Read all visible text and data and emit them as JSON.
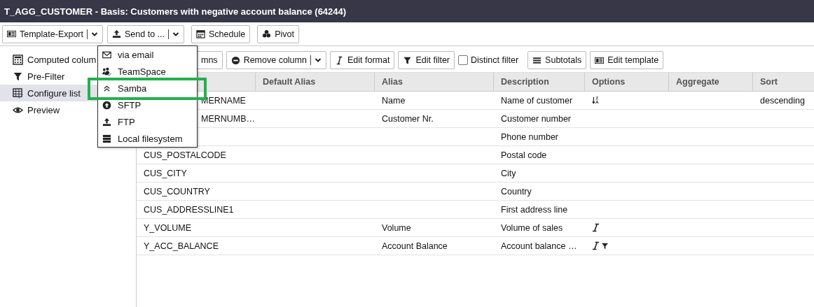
{
  "window": {
    "title": "T_AGG_CUSTOMER - Basis: Customers with negative account balance (64244)"
  },
  "toolbar": [
    {
      "label": "Template-Export",
      "kind": "split"
    },
    {
      "label": "Send to ...",
      "kind": "split"
    },
    {
      "label": "Schedule",
      "kind": "button"
    },
    {
      "label": "Pivot",
      "kind": "button"
    }
  ],
  "send_menu": {
    "items": [
      {
        "label": "via email",
        "highlighted": false
      },
      {
        "label": "TeamSpace",
        "highlighted": false
      },
      {
        "label": "Samba",
        "highlighted": true
      },
      {
        "label": "SFTP",
        "highlighted": false
      },
      {
        "label": "FTP",
        "highlighted": false
      },
      {
        "label": "Local filesystem",
        "highlighted": false
      }
    ]
  },
  "sidebar": {
    "items": [
      {
        "label": "Computed colum",
        "selected": false
      },
      {
        "label": "Pre-Filter",
        "selected": false
      },
      {
        "label": "Configure list",
        "selected": true
      },
      {
        "label": "Preview",
        "selected": false
      }
    ]
  },
  "list_toolbar": [
    {
      "label": "mns",
      "kind": "button"
    },
    {
      "label": "Remove column",
      "kind": "split"
    },
    {
      "label": "Edit format",
      "kind": "button"
    },
    {
      "label": "Edit filter",
      "kind": "button"
    },
    {
      "label": "Distinct filter",
      "kind": "checkbox",
      "checked": false
    },
    {
      "label": "Subtotals",
      "kind": "button"
    },
    {
      "label": "Edit template",
      "kind": "button"
    }
  ],
  "table": {
    "columns": [
      "Default Alias",
      "Alias",
      "Description",
      "Options",
      "Aggregate",
      "Sort"
    ],
    "rows": [
      {
        "field": "MERNAME",
        "covered": true,
        "alias": "Name",
        "description": "Name of customer",
        "sorted_desc": true,
        "formatted": false,
        "filtered": false,
        "sort": "descending"
      },
      {
        "field": "MERNUMB…",
        "covered": true,
        "alias": "Customer Nr.",
        "description": "Customer number",
        "sorted_desc": false,
        "formatted": false,
        "filtered": false
      },
      {
        "covered": true,
        "description": "Phone number",
        "sorted_desc": false,
        "formatted": false,
        "filtered": false
      },
      {
        "field": "CUS_POSTALCODE",
        "covered": false,
        "description": "Postal code",
        "sorted_desc": false,
        "formatted": false,
        "filtered": false
      },
      {
        "field": "CUS_CITY",
        "covered": false,
        "description": "City",
        "sorted_desc": false,
        "formatted": false,
        "filtered": false
      },
      {
        "field": "CUS_COUNTRY",
        "covered": false,
        "description": "Country",
        "sorted_desc": false,
        "formatted": false,
        "filtered": false
      },
      {
        "field": "CUS_ADDRESSLINE1",
        "covered": false,
        "description": "First address line",
        "sorted_desc": false,
        "formatted": false,
        "filtered": false
      },
      {
        "field": "Y_VOLUME",
        "covered": false,
        "alias": "Volume",
        "description": "Volume of sales",
        "sorted_desc": false,
        "formatted": true,
        "filtered": false
      },
      {
        "field": "Y_ACC_BALANCE",
        "covered": false,
        "alias": "Account Balance",
        "description": "Account balance …",
        "sorted_desc": false,
        "formatted": true,
        "filtered": true
      }
    ]
  }
}
